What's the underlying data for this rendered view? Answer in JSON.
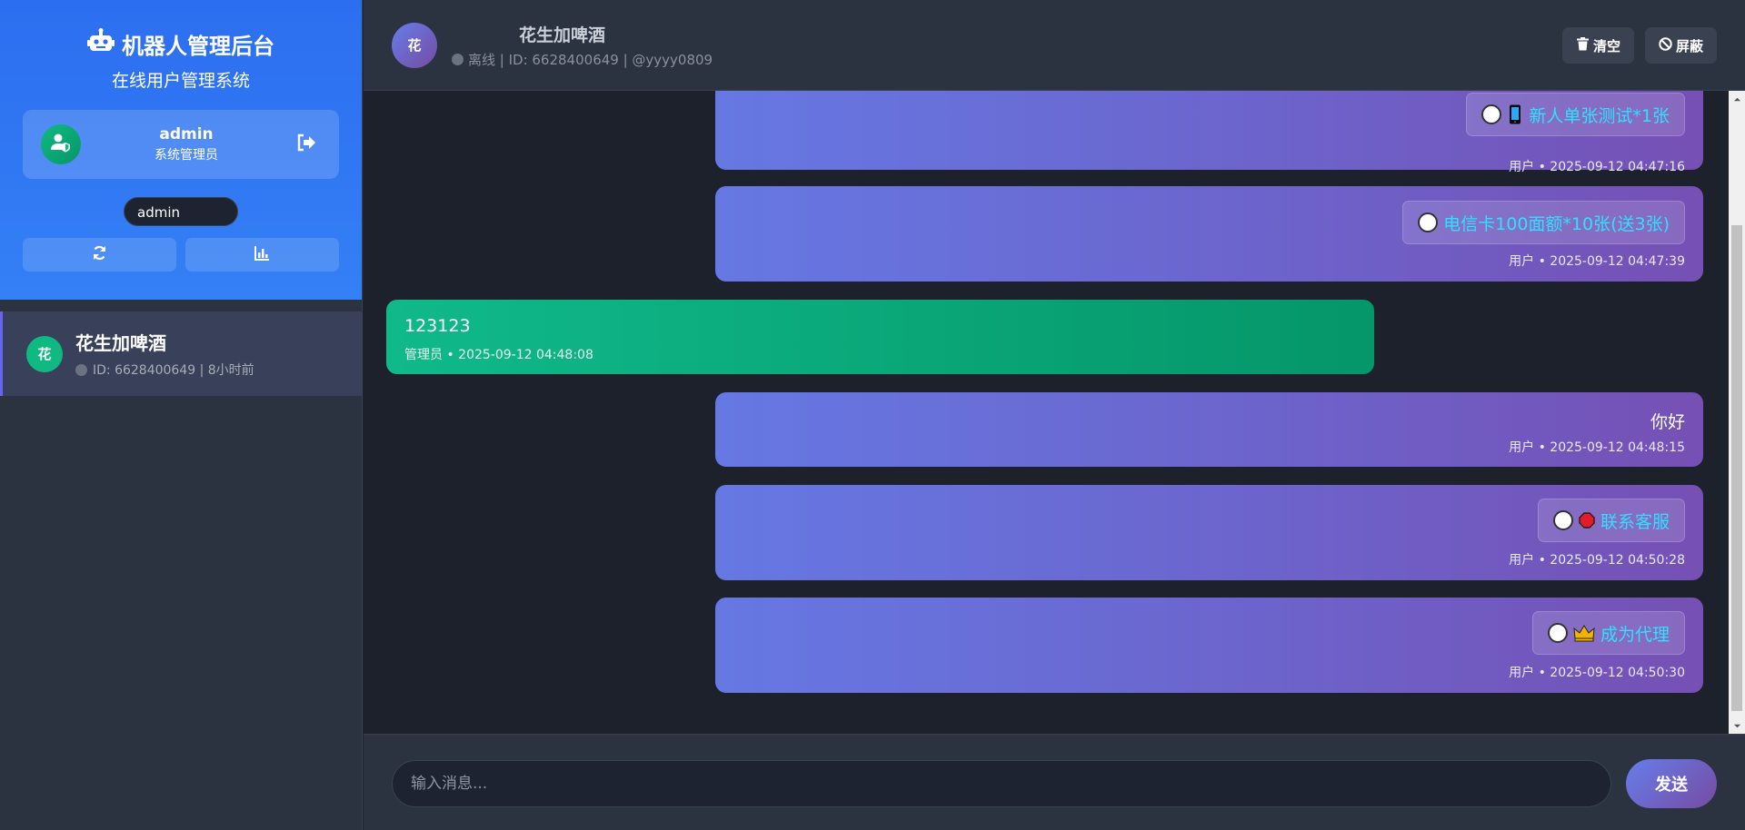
{
  "sidebar": {
    "brand_title": "机器人管理后台",
    "brand_subtitle": "在线用户管理系统",
    "user": {
      "name": "admin",
      "role": "系统管理员"
    },
    "admin_pill": "admin",
    "contacts": [
      {
        "avatar": "花",
        "name": "花生加啤酒",
        "meta": "ID: 6628400649 | 8小时前",
        "status": "offline"
      }
    ]
  },
  "header": {
    "avatar": "花",
    "name": "花生加啤酒",
    "meta": "离线 | ID: 6628400649 | @yyyy0809",
    "clear_label": "清空",
    "block_label": "屏蔽"
  },
  "messages": [
    {
      "sender": "user",
      "chip": "新人单张测试*1张",
      "emoji": "phone-icon",
      "time": "用户 • 2025-09-12 04:47:16"
    },
    {
      "sender": "user",
      "chip": "电信卡100面额*10张(送3张)",
      "emoji": "",
      "time": "用户 • 2025-09-12 04:47:39"
    },
    {
      "sender": "admin",
      "text": "123123",
      "time": "管理员 • 2025-09-12 04:48:08"
    },
    {
      "sender": "user",
      "text": "你好",
      "time": "用户 • 2025-09-12 04:48:15"
    },
    {
      "sender": "user",
      "chip": "联系客服",
      "emoji": "stop-sign-icon",
      "time": "用户 • 2025-09-12 04:50:28"
    },
    {
      "sender": "user",
      "chip": "成为代理",
      "emoji": "crown-icon",
      "time": "用户 • 2025-09-12 04:50:30"
    }
  ],
  "composer": {
    "placeholder": "输入消息...",
    "send_label": "发送"
  },
  "colors": {
    "accent": "#6366f1",
    "sidebar_header": "#2c6ef0",
    "admin_bubble": "#10b981",
    "user_bubble_start": "#667eea",
    "user_bubble_end": "#764ba2",
    "chip_text": "#2fe0ff"
  }
}
